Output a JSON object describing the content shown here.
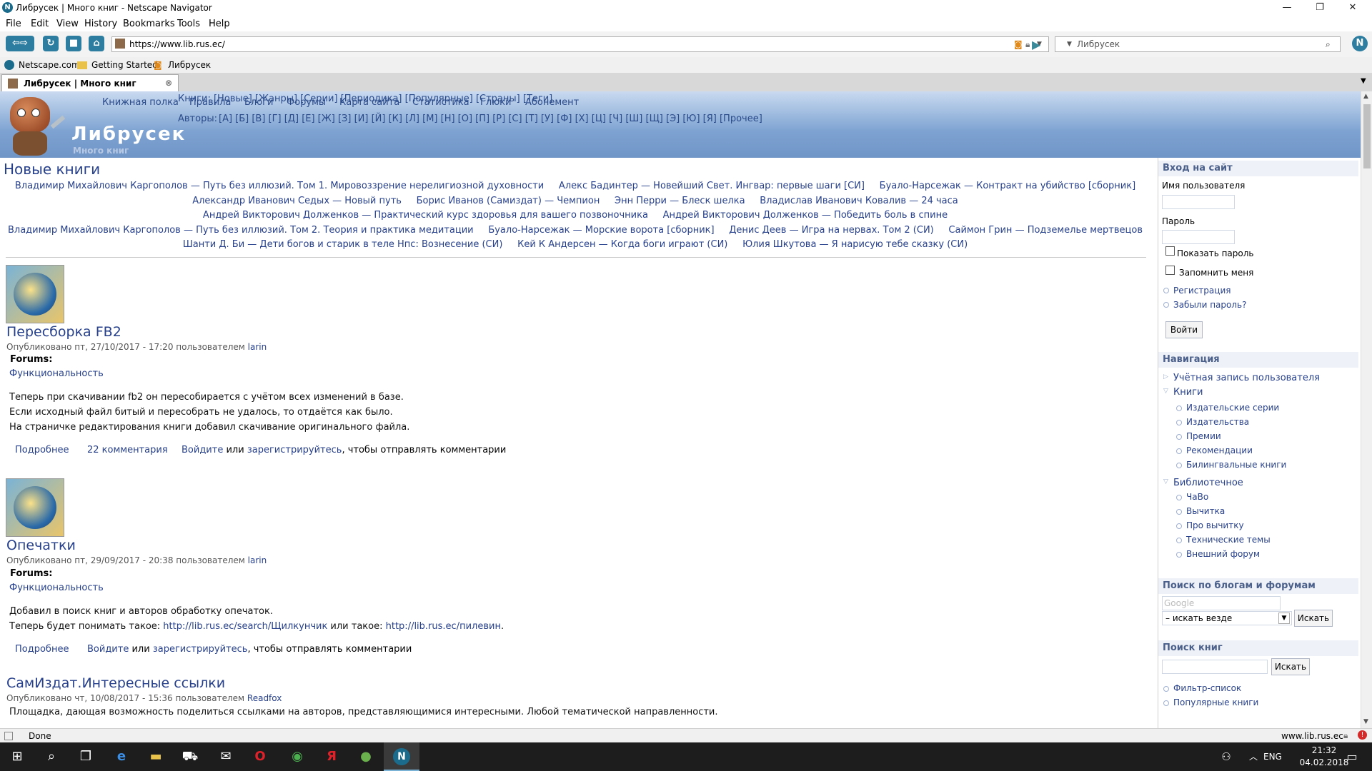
{
  "window": {
    "title": "Либрусек | Много книг - Netscape Navigator"
  },
  "menu": [
    "File",
    "Edit",
    "View",
    "History",
    "Bookmarks",
    "Tools",
    "Help"
  ],
  "navbar": {
    "url": "https://www.lib.rus.ec/",
    "search_value": "Либрусек"
  },
  "bookmarks": [
    "Netscape.com",
    "Getting Started",
    "Либрусек"
  ],
  "tab": {
    "label": "Либрусек | Много книг"
  },
  "header": {
    "nav_links": [
      "Книжная полка",
      "Правила",
      "Блоги",
      "Форумы",
      "Карта сайта",
      "Статистика",
      "Глюки",
      "Абонемент"
    ],
    "books_line": "Книги: [Новые] [Жанры] [Серии] [Периодика] [Популярные] [Страны] [Теги]",
    "authors_label": "Авторы:",
    "authors_letters": "[А] [Б] [В] [Г] [Д] [Е] [Ж] [З] [И] [Й] [К] [Л] [М] [Н] [О] [П] [Р] [С] [Т] [У] [Ф] [Х] [Ц] [Ч] [Ш] [Щ] [Э] [Ю] [Я] [Прочее]",
    "site_name": "Либрусек",
    "slogan": "Много книг"
  },
  "new_books": {
    "title": "Новые книги",
    "lines": [
      [
        "Владимир Михайлович Каргополов — Путь без иллюзий. Том 1. Мировоззрение нерелигиозной духовности",
        "Алекс Бадинтер — Новейший Свет. Ингвар: первые шаги [СИ]",
        "Буало-Нарсежак — Контракт на убийство [сборник]"
      ],
      [
        "Александр Иванович Седых — Новый путь",
        "Борис Иванов (Самиздат) — Чемпион",
        "Энн Перри — Блеск шелка",
        "Владислав Иванович Ковалив — 24 часа"
      ],
      [
        "Андрей Викторович Долженков — Практический курс здоровья для вашего позвоночника",
        "Андрей Викторович Долженков — Победить боль в спине"
      ],
      [
        "Владимир Михайлович Каргополов — Путь без иллюзий. Том 2. Теория и практика медитации",
        "Буало-Нарсежак — Морские ворота [сборник]",
        "Денис Деев — Игра на нервах. Том 2 (СИ)",
        "Саймон Грин — Подземелье мертвецов"
      ],
      [
        "Шанти Д. Би — Дети богов и старик в теле Нпс: Вознесение (СИ)",
        "Кей К Андерсен — Когда боги играют (СИ)",
        "Юлия Шкутова — Я нарисую тебе сказку (СИ)"
      ]
    ]
  },
  "posts": [
    {
      "title": "Пересборка FB2",
      "meta": "Опубликовано пт, 27/10/2017 - 17:20 пользователем",
      "author": "larin",
      "forums_label": "Forums:",
      "forum": "Функциональность",
      "body": [
        "Теперь при скачивании fb2 он пересобирается с учётом всех изменений в базе.",
        "Если исходный файл битый и пересобрать не удалось, то отдаётся как было.",
        "На страничке редактирования книги добавил скачивание оригинального файла."
      ],
      "more": "Подробнее",
      "comments": "22 комментария",
      "login_text_a": "Войдите",
      "login_text_b": " или ",
      "login_text_c": "зарегистрируйтесь",
      "login_text_d": ", чтобы отправлять комментарии"
    },
    {
      "title": "Опечатки",
      "meta": "Опубликовано пт, 29/09/2017 - 20:38 пользователем",
      "author": "larin",
      "forums_label": "Forums:",
      "forum": "Функциональность",
      "body_1": "Добавил в поиск книг и авторов обработку опечаток.",
      "body_2a": "Теперь будет понимать такое: ",
      "body_2b": "http://lib.rus.ec/search/Щилкунчик",
      "body_2c": " или такое: ",
      "body_2d": "http://lib.rus.ec/пилевин",
      "body_2e": ".",
      "more": "Подробнее",
      "login_text_a": "Войдите",
      "login_text_b": " или ",
      "login_text_c": "зарегистрируйтесь",
      "login_text_d": ", чтобы отправлять комментарии"
    },
    {
      "title": "СамИздат.Интересные ссылки",
      "meta": "Опубликовано чт, 10/08/2017 - 15:36 пользователем",
      "author": "Readfox",
      "body": "Площадка, дающая возможность поделиться ссылками на авторов, представляющимися интересными. Любой тематической направленности."
    }
  ],
  "sidebar": {
    "login": {
      "title": "Вход на сайт",
      "username_label": "Имя пользователя",
      "password_label": "Пароль",
      "show_password": "Показать пароль",
      "remember": "Запомнить меня",
      "register": "Регистрация",
      "forgot": "Забыли пароль?",
      "submit": "Войти"
    },
    "navigation": {
      "title": "Навигация",
      "account": "Учётная запись пользователя",
      "books": "Книги",
      "books_items": [
        "Издательские серии",
        "Издательства",
        "Премии",
        "Рекомендации",
        "Билингвальные книги"
      ],
      "library": "Библиотечное",
      "library_items": [
        "ЧаВо",
        "Вычитка",
        "Про вычитку",
        "Технические темы",
        "Внешний форум"
      ]
    },
    "blog_search": {
      "title": "Поиск по блогам и форумам",
      "placeholder": "Google",
      "scope": "– искать везде",
      "button": "Искать"
    },
    "book_search": {
      "title": "Поиск книг",
      "button": "Искать",
      "links": [
        "Фильтр-список",
        "Популярные книги"
      ]
    }
  },
  "status": {
    "text": "Done",
    "domain": "www.lib.rus.ec"
  },
  "taskbar": {
    "lang": "ENG",
    "time": "21:32",
    "date": "04.02.2018"
  }
}
